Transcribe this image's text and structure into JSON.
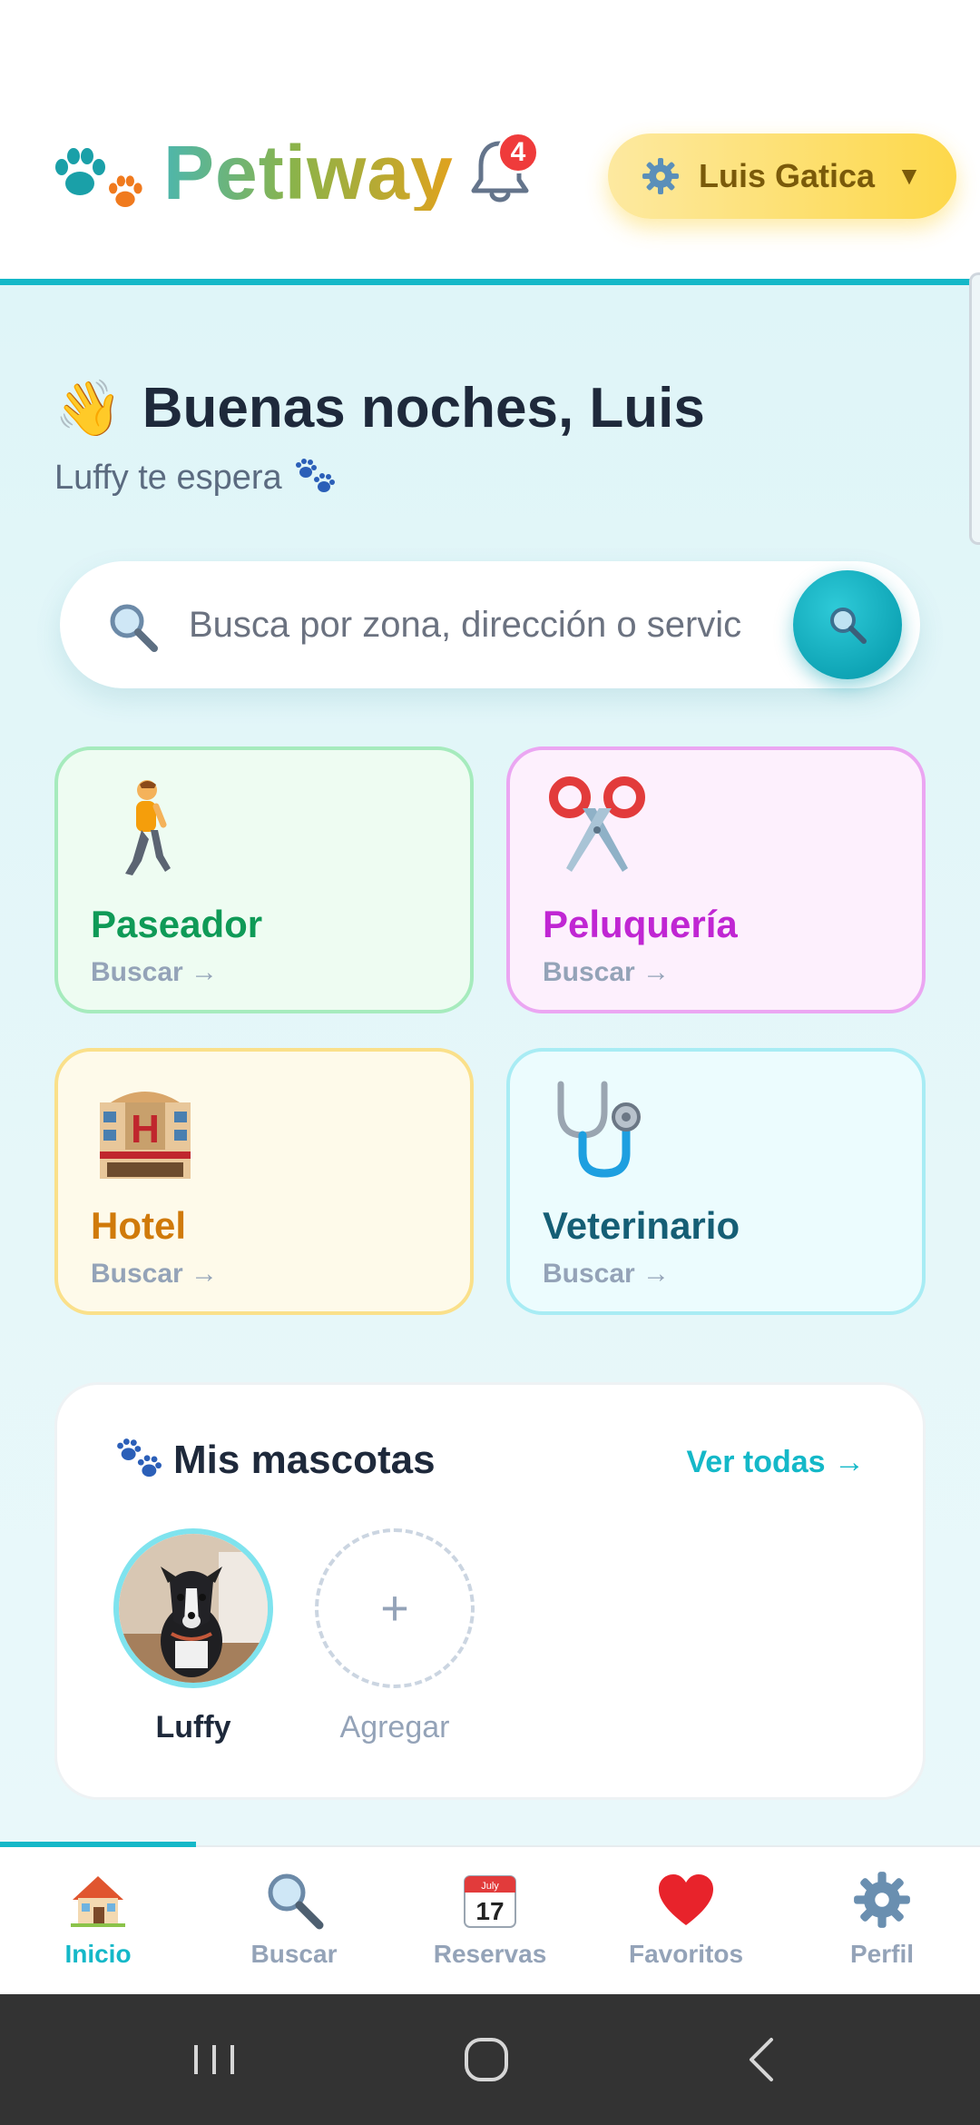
{
  "header": {
    "app_name": "Petiway",
    "notification_count": "4",
    "user_name": "Luis Gatica",
    "user_caret": "▼"
  },
  "greeting": {
    "emoji": "👋",
    "title": "Buenas noches, Luis",
    "subtitle": "Luffy te espera"
  },
  "search": {
    "placeholder": "Busca por zona, dirección o servic"
  },
  "categories": [
    {
      "title": "Paseador",
      "action": "Buscar →",
      "icon": "person-walking-icon"
    },
    {
      "title": "Peluquería",
      "action": "Buscar →",
      "icon": "scissors-icon"
    },
    {
      "title": "Hotel",
      "action": "Buscar →",
      "icon": "hotel-icon"
    },
    {
      "title": "Veterinario",
      "action": "Buscar →",
      "icon": "stethoscope-icon"
    }
  ],
  "pets": {
    "title": "Mis mascotas",
    "see_all": "Ver todas →",
    "items": [
      {
        "name": "Luffy"
      }
    ],
    "add_label": "Agregar",
    "add_symbol": "+"
  },
  "bottom_nav": [
    {
      "label": "Inicio",
      "icon": "home-icon",
      "active": true
    },
    {
      "label": "Buscar",
      "icon": "magnifier-icon",
      "active": false
    },
    {
      "label": "Reservas",
      "icon": "calendar-icon",
      "active": false,
      "calendar_month": "July",
      "calendar_day": "17"
    },
    {
      "label": "Favoritos",
      "icon": "heart-icon",
      "active": false
    },
    {
      "label": "Perfil",
      "icon": "gear-icon",
      "active": false
    }
  ],
  "colors": {
    "accent": "#14b8c8",
    "badge": "#ef3b3b",
    "user_pill": "#fdd84a"
  }
}
